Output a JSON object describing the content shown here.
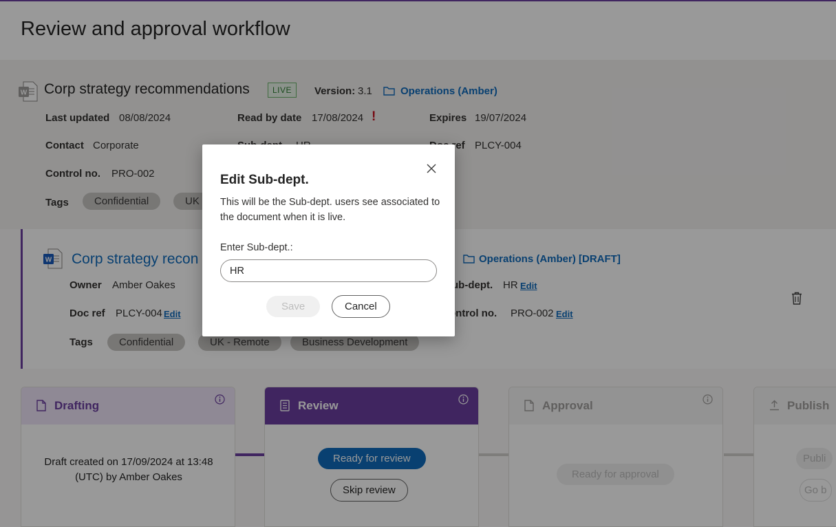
{
  "page": {
    "title": "Review and approval workflow"
  },
  "live_doc": {
    "title": "Corp strategy recommendations",
    "status": "LIVE",
    "version_label": "Version:",
    "version_value": "3.1",
    "location": "Operations (Amber)",
    "fields": {
      "last_updated_label": "Last updated",
      "last_updated_value": "08/08/2024",
      "read_by_label": "Read by date",
      "read_by_value": "17/08/2024",
      "read_by_alert": "!",
      "expires_label": "Expires",
      "expires_value": "19/07/2024",
      "contact_label": "Contact",
      "contact_value": "Corporate",
      "subdept_label": "Sub-dept.",
      "subdept_value": "HR",
      "docref_label": "Doc ref",
      "docref_value": "PLCY-004",
      "control_label": "Control no.",
      "control_value": "PRO-002",
      "tags_label": "Tags"
    },
    "tags": [
      "Confidential",
      "UK"
    ]
  },
  "draft_doc": {
    "title": "Corp strategy recon",
    "location": "Operations (Amber) [DRAFT]",
    "fields": {
      "owner_label": "Owner",
      "owner_value": "Amber Oakes",
      "docref_label": "Doc ref",
      "docref_value": "PLCY-004",
      "subdept_label": "ub-dept.",
      "subdept_value": "HR",
      "control_label": "ontrol no.",
      "control_value": "PRO-002",
      "tags_label": "Tags",
      "edit_label": "Edit"
    },
    "tags": [
      "Confidential",
      "UK - Remote",
      "Business Development"
    ]
  },
  "workflow": {
    "drafting": {
      "title": "Drafting",
      "text": "Draft created on 17/09/2024 at 13:48 (UTC) by Amber Oakes"
    },
    "review": {
      "title": "Review",
      "ready_button": "Ready for review",
      "skip_button": "Skip review"
    },
    "approval": {
      "title": "Approval",
      "ready_button": "Ready for approval"
    },
    "publish": {
      "title": "Publish",
      "button_1": "Publi",
      "button_2": "Go b"
    }
  },
  "dialog": {
    "title": "Edit Sub-dept.",
    "description": "This will be the Sub-dept. users see associated to the document when it is live.",
    "input_label": "Enter Sub-dept.:",
    "input_value": "HR",
    "save_label": "Save",
    "cancel_label": "Cancel"
  },
  "colors": {
    "accent_purple": "#6b3fa0",
    "link_blue": "#0f6cbd",
    "live_green": "#2e7d32",
    "alert_red": "#c50f1f"
  },
  "icons": [
    "word-doc-icon",
    "folder-icon",
    "trash-icon",
    "info-icon",
    "close-icon",
    "document-icon",
    "checklist-icon",
    "upload-icon"
  ]
}
